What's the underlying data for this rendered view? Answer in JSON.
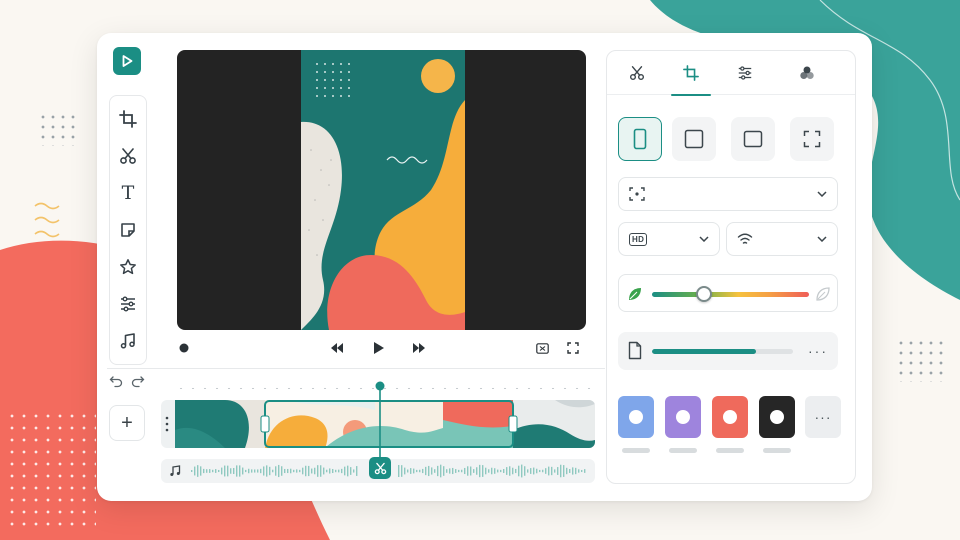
{
  "colors": {
    "accent": "#1b8e84",
    "coral": "#ef6a5c",
    "teal_bg": "#3aa39a"
  },
  "rail": {
    "tools": [
      "crop-icon",
      "scissors-icon",
      "text-icon",
      "sticker-icon",
      "star-icon",
      "adjust-icon",
      "music-icon"
    ],
    "text_glyph": "T"
  },
  "add_button": {
    "label": "+"
  },
  "panel": {
    "tabs": [
      "scissors-icon",
      "crop-icon",
      "sliders-icon",
      "effects-icon"
    ],
    "active_tab": 1,
    "ratios": [
      "portrait",
      "square",
      "landscape",
      "freeform"
    ],
    "quality_badge": "HD",
    "filter_strength": 0.33,
    "export_progress": 0.74,
    "more": "···",
    "swatches": [
      "#7fa6ea",
      "#9e84dd",
      "#ef6a5c",
      "#262626"
    ],
    "more_swatches": "···"
  }
}
